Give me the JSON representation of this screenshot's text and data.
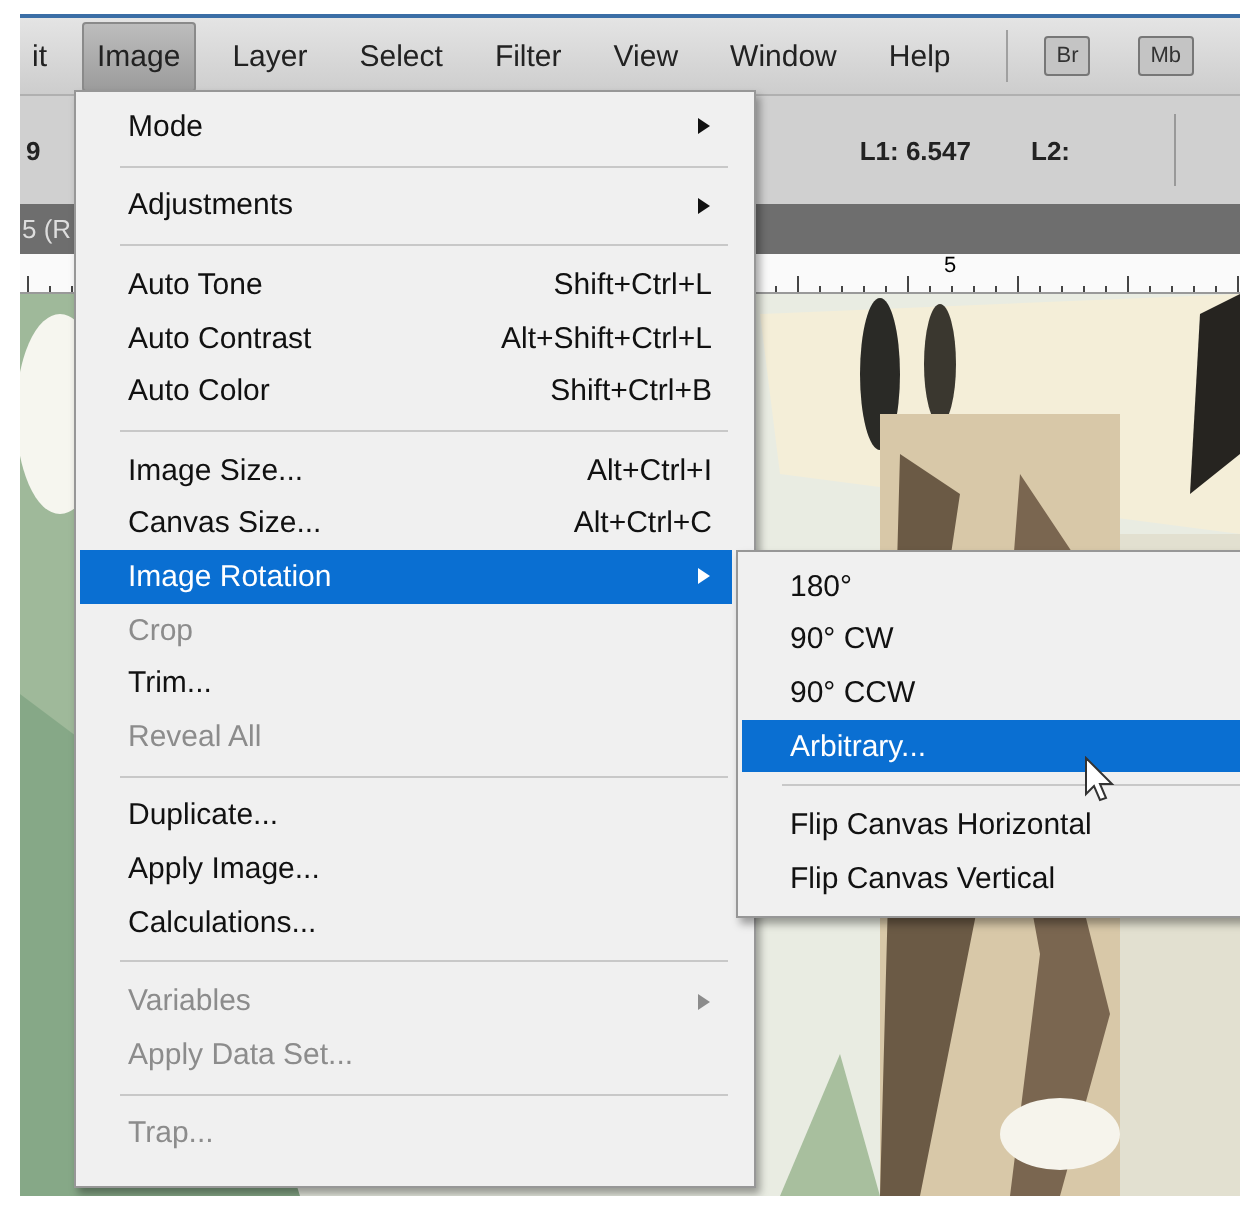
{
  "menubar": {
    "items": [
      {
        "label": "it",
        "selected": false
      },
      {
        "label": "Image",
        "selected": true
      },
      {
        "label": "Layer",
        "selected": false
      },
      {
        "label": "Select",
        "selected": false
      },
      {
        "label": "Filter",
        "selected": false
      },
      {
        "label": "View",
        "selected": false
      },
      {
        "label": "Window",
        "selected": false
      },
      {
        "label": "Help",
        "selected": false
      }
    ],
    "buttons": [
      "Br",
      "Mb"
    ]
  },
  "options_bar": {
    "field_1": "9",
    "l1": "L1: 6.547",
    "l2": "L2:"
  },
  "document_tab": {
    "title": "5 (R"
  },
  "ruler": {
    "label": "5"
  },
  "image_menu": {
    "items": [
      {
        "kind": "item",
        "label": "Mode",
        "submenu": true,
        "disabled": false,
        "selected": false
      },
      {
        "kind": "separator"
      },
      {
        "kind": "item",
        "label": "Adjustments",
        "submenu": true,
        "disabled": false,
        "selected": false
      },
      {
        "kind": "separator"
      },
      {
        "kind": "item",
        "label": "Auto Tone",
        "shortcut": "Shift+Ctrl+L",
        "submenu": false,
        "disabled": false,
        "selected": false
      },
      {
        "kind": "item",
        "label": "Auto Contrast",
        "shortcut": "Alt+Shift+Ctrl+L",
        "submenu": false,
        "disabled": false,
        "selected": false
      },
      {
        "kind": "item",
        "label": "Auto Color",
        "shortcut": "Shift+Ctrl+B",
        "submenu": false,
        "disabled": false,
        "selected": false
      },
      {
        "kind": "separator"
      },
      {
        "kind": "item",
        "label": "Image Size...",
        "shortcut": "Alt+Ctrl+I",
        "submenu": false,
        "disabled": false,
        "selected": false
      },
      {
        "kind": "item",
        "label": "Canvas Size...",
        "shortcut": "Alt+Ctrl+C",
        "submenu": false,
        "disabled": false,
        "selected": false
      },
      {
        "kind": "item",
        "label": "Image Rotation",
        "submenu": true,
        "disabled": false,
        "selected": true
      },
      {
        "kind": "item",
        "label": "Crop",
        "submenu": false,
        "disabled": true,
        "selected": false
      },
      {
        "kind": "item",
        "label": "Trim...",
        "submenu": false,
        "disabled": false,
        "selected": false
      },
      {
        "kind": "item",
        "label": "Reveal All",
        "submenu": false,
        "disabled": true,
        "selected": false
      },
      {
        "kind": "separator"
      },
      {
        "kind": "item",
        "label": "Duplicate...",
        "submenu": false,
        "disabled": false,
        "selected": false
      },
      {
        "kind": "item",
        "label": "Apply Image...",
        "submenu": false,
        "disabled": false,
        "selected": false
      },
      {
        "kind": "item",
        "label": "Calculations...",
        "submenu": false,
        "disabled": false,
        "selected": false
      },
      {
        "kind": "separator"
      },
      {
        "kind": "item",
        "label": "Variables",
        "submenu": true,
        "disabled": true,
        "selected": false
      },
      {
        "kind": "item",
        "label": "Apply Data Set...",
        "submenu": false,
        "disabled": true,
        "selected": false
      },
      {
        "kind": "separator"
      },
      {
        "kind": "item",
        "label": "Trap...",
        "submenu": false,
        "disabled": true,
        "selected": false
      }
    ]
  },
  "rotation_submenu": {
    "items": [
      {
        "kind": "item",
        "label": "180°",
        "submenu": false,
        "disabled": false,
        "selected": false
      },
      {
        "kind": "item",
        "label": "90° CW",
        "submenu": false,
        "disabled": false,
        "selected": false
      },
      {
        "kind": "item",
        "label": "90° CCW",
        "submenu": false,
        "disabled": false,
        "selected": false
      },
      {
        "kind": "item",
        "label": "Arbitrary...",
        "submenu": false,
        "disabled": false,
        "selected": true
      },
      {
        "kind": "separator"
      },
      {
        "kind": "item",
        "label": "Flip Canvas Horizontal",
        "submenu": false,
        "disabled": false,
        "selected": false
      },
      {
        "kind": "item",
        "label": "Flip Canvas Vertical",
        "submenu": false,
        "disabled": false,
        "selected": false
      }
    ]
  }
}
